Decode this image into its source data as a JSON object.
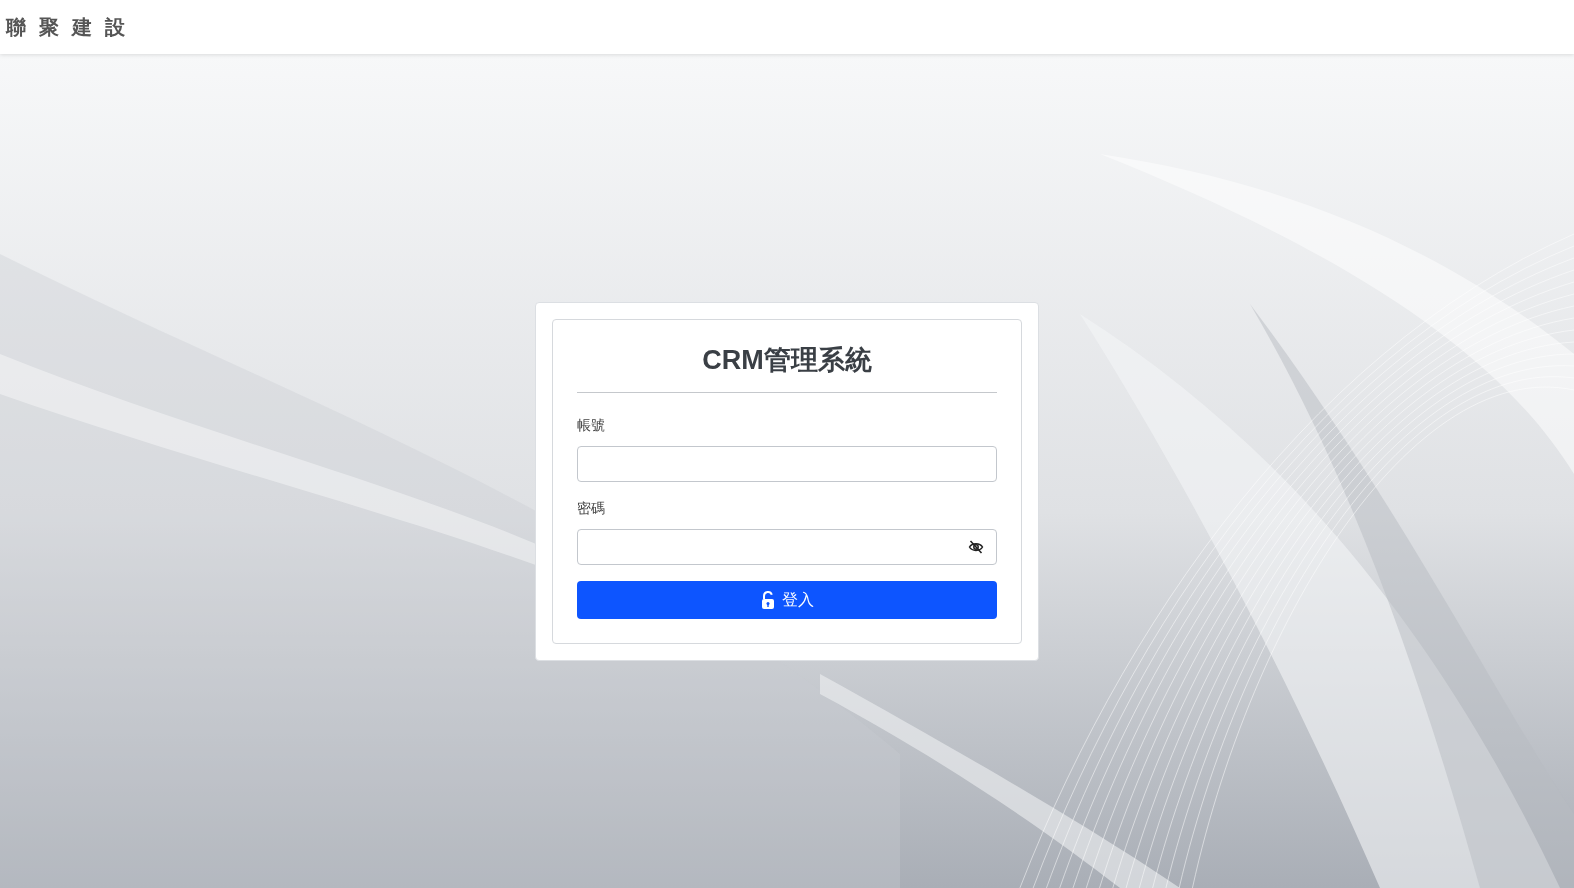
{
  "header": {
    "logo": "聯 聚 建 設"
  },
  "login": {
    "title": "CRM管理系統",
    "fields": [
      {
        "kind": "text",
        "label": "帳號"
      },
      {
        "kind": "password",
        "label": "密碼"
      }
    ],
    "submit": "登入"
  }
}
